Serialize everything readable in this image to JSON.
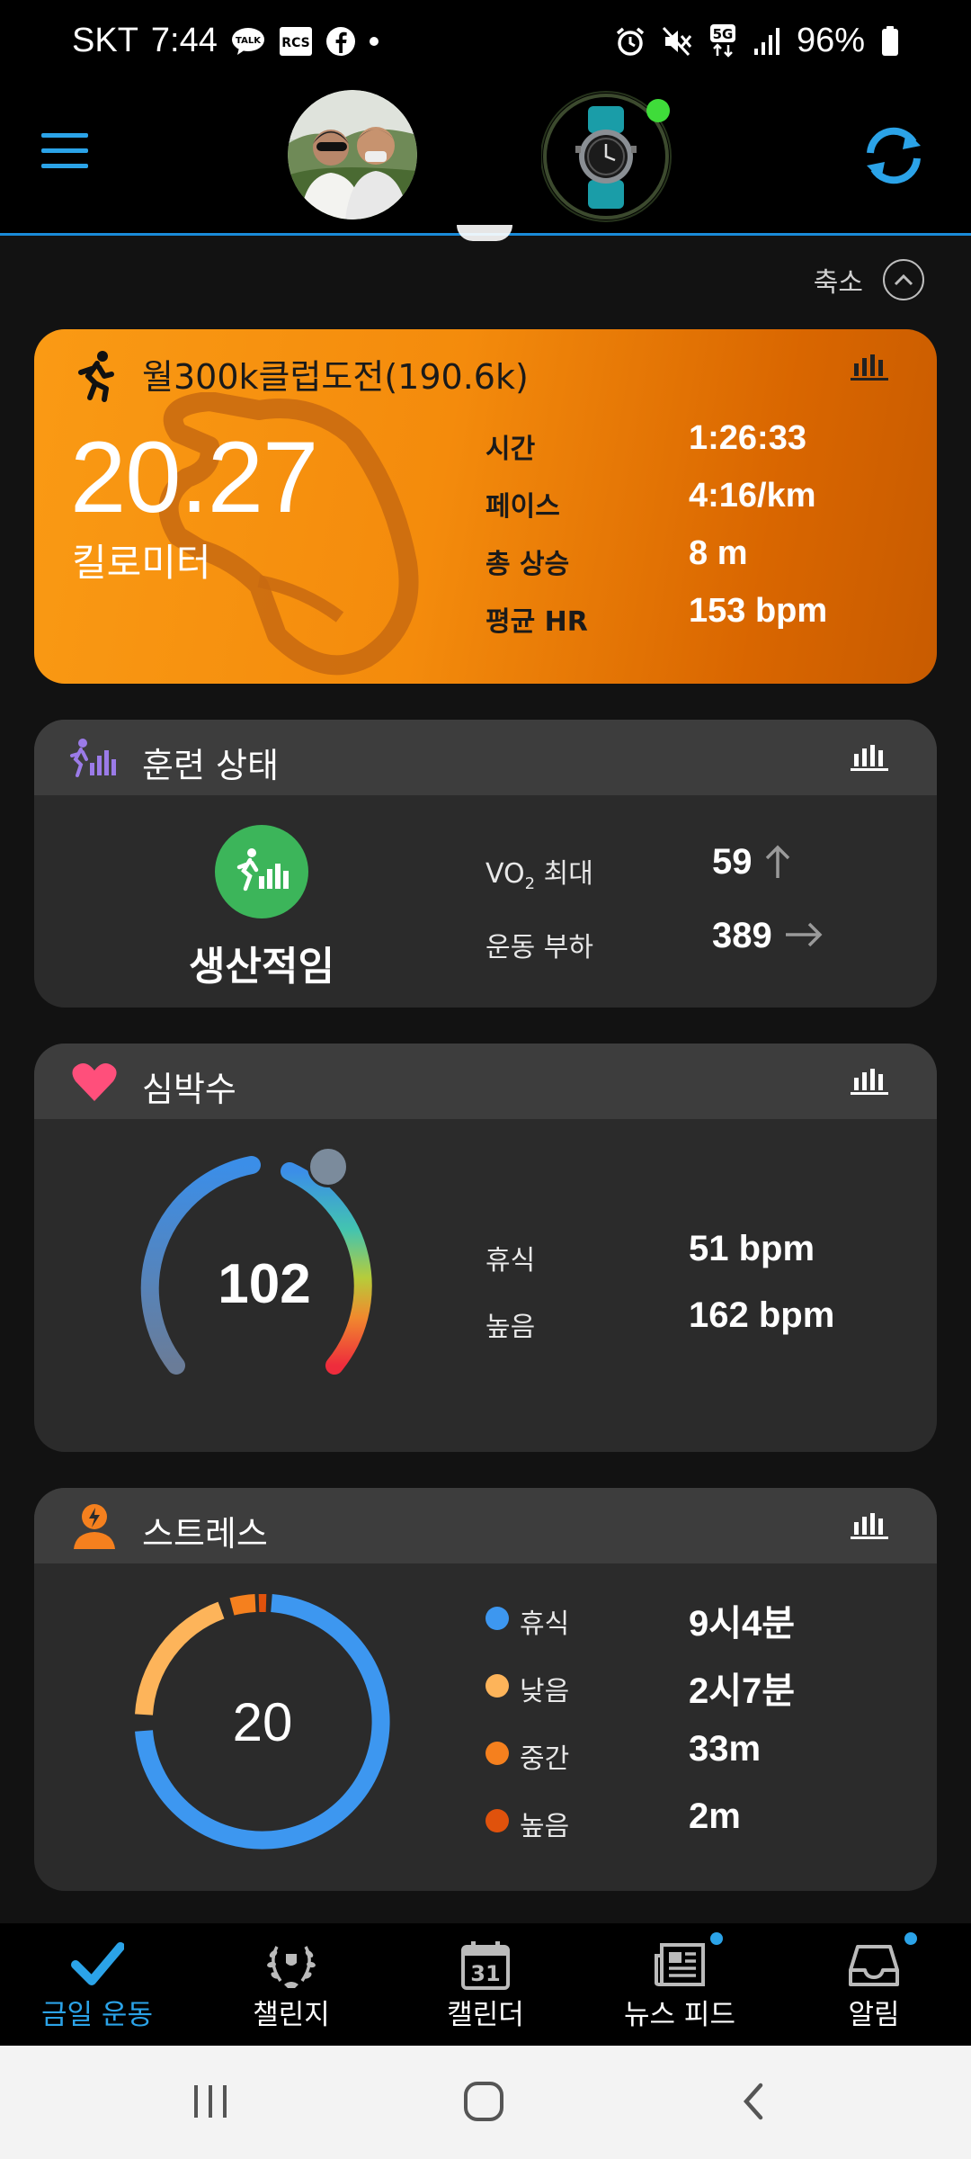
{
  "status_bar": {
    "carrier": "SKT",
    "time": "7:44",
    "network": "5G",
    "battery": "96%"
  },
  "header": {
    "collapse_label": "축소"
  },
  "activity": {
    "title": "월300k클럽도전(190.6k)",
    "distance": "20.27",
    "distance_unit": "킬로미터",
    "stats": [
      {
        "label": "시간",
        "value": "1:26:33"
      },
      {
        "label": "페이스",
        "value": "4:16/km"
      },
      {
        "label": "총 상승",
        "value": "8 m"
      },
      {
        "label": "평균 HR",
        "value": "153 bpm"
      }
    ]
  },
  "training": {
    "title": "훈련 상태",
    "status": "생산적임",
    "vo2_label_prefix": "VO",
    "vo2_label_sub": "2",
    "vo2_label_suffix": " 최대",
    "vo2_value": "59",
    "load_label": "운동 부하",
    "load_value": "389"
  },
  "heart": {
    "title": "심박수",
    "current": "102",
    "rest_label": "휴식",
    "rest_value": "51 bpm",
    "high_label": "높음",
    "high_value": "162 bpm"
  },
  "stress": {
    "title": "스트레스",
    "score": "20",
    "levels": [
      {
        "label": "휴식",
        "value": "9시4분",
        "color": "#3d97f0"
      },
      {
        "label": "낮음",
        "value": "2시7분",
        "color": "#fdb45a"
      },
      {
        "label": "중간",
        "value": "33m",
        "color": "#f5801e"
      },
      {
        "label": "높음",
        "value": "2m",
        "color": "#e0520c"
      }
    ]
  },
  "nav": {
    "items": [
      {
        "label": "금일 운동",
        "active": true
      },
      {
        "label": "챌린지"
      },
      {
        "label": "캘린더",
        "calendar_day": "31"
      },
      {
        "label": "뉴스 피드"
      },
      {
        "label": "알림"
      }
    ]
  },
  "colors": {
    "accent": "#2ba3e8",
    "activity_orange": "#f48b0c",
    "productive_green": "#3cb55a",
    "heart_pink": "#ff4f7b"
  }
}
